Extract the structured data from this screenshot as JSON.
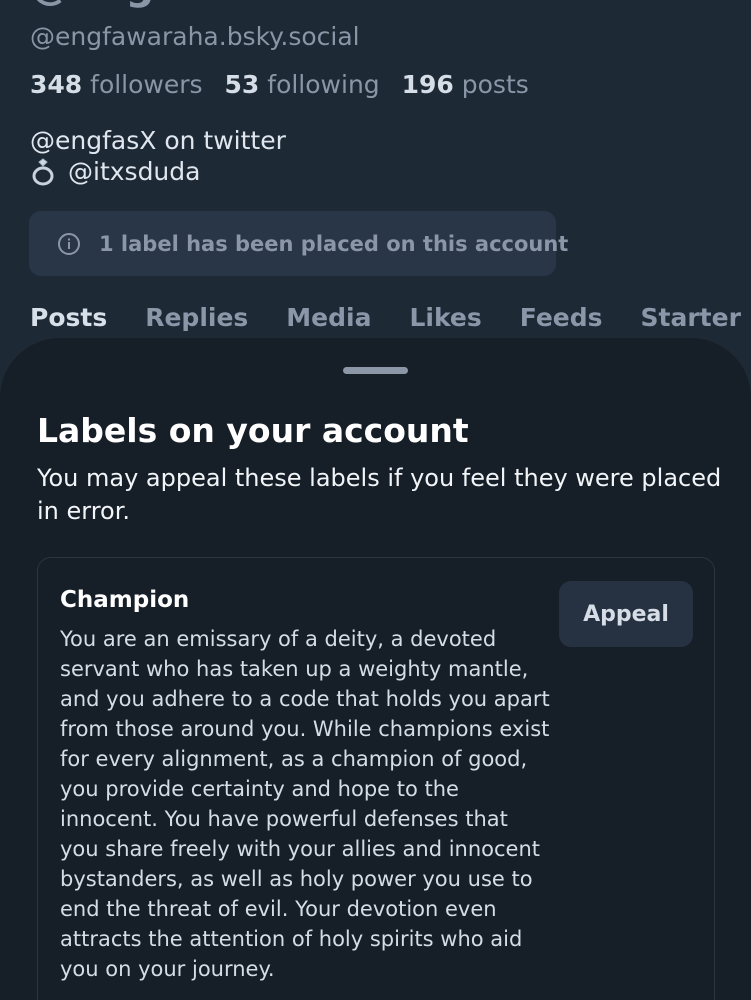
{
  "profile": {
    "display_name": "@eng",
    "handle": "@engfawaraha.bsky.social",
    "stats": {
      "followers_count": "348",
      "followers_label": "followers",
      "following_count": "53",
      "following_label": "following",
      "posts_count": "196",
      "posts_label": "posts"
    },
    "bio": {
      "line1": "@engfasX on twitter",
      "line2": "@itxsduda",
      "line2_icon": "ring-icon"
    },
    "label_notice": {
      "icon": "info-icon",
      "text": "1 label has been placed on this account"
    },
    "tabs": [
      {
        "label": "Posts",
        "active": true
      },
      {
        "label": "Replies",
        "active": false
      },
      {
        "label": "Media",
        "active": false
      },
      {
        "label": "Likes",
        "active": false
      },
      {
        "label": "Feeds",
        "active": false
      },
      {
        "label": "Starter Packs",
        "active": false
      }
    ]
  },
  "sheet": {
    "title": "Labels on your account",
    "subtitle": "You may appeal these labels if you feel they were placed in error.",
    "labels": [
      {
        "name": "Champion",
        "description": "You are an emissary of a deity, a devoted servant who has taken up a weighty mantle, and you adhere to a code that holds you apart from those around you. While champions exist for every alignment, as a champion of good, you provide certainty and hope to the innocent. You have powerful defenses that you share freely with your allies and innocent bystanders, as well as holy power you use to end the threat of evil. Your devotion even attracts the attention of holy spirits who aid you on your journey.",
        "appeal_label": "Appeal"
      }
    ]
  },
  "colors": {
    "background": "#1e2936",
    "sheet_background": "#161e27",
    "notice_background": "#293647",
    "muted_text": "#8b97a8",
    "primary_text": "#ffffff"
  }
}
